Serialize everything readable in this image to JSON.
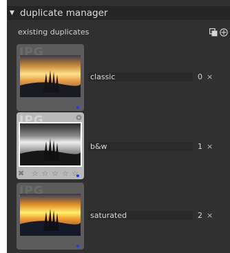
{
  "header": {
    "arrow": "▼",
    "title": "duplicate manager"
  },
  "section": {
    "label": "existing duplicates",
    "icons": [
      "copy-icon",
      "add-icon"
    ]
  },
  "duplicates": [
    {
      "ext": "JPG",
      "name": "classic",
      "version": "0",
      "delete": "×",
      "active": false,
      "style": "color-sunset"
    },
    {
      "ext": "JPG",
      "name": "b&w",
      "version": "1",
      "delete": "×",
      "active": true,
      "style": "monochrome",
      "rating": {
        "reject": "✖",
        "stars": [
          "☆",
          "☆",
          "☆",
          "☆",
          "☆"
        ]
      }
    },
    {
      "ext": "JPG",
      "name": "saturated",
      "version": "2",
      "delete": "×",
      "active": false,
      "style": "color-sunset"
    }
  ],
  "colors": {
    "panel": "#303030",
    "header": "#252525",
    "color_label_dot": "#1a3cff"
  }
}
